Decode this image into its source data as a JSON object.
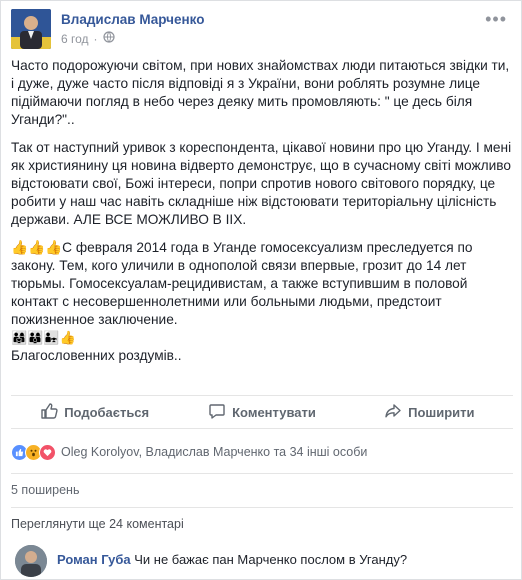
{
  "post": {
    "author": "Владислав Марченко",
    "time": "6 год",
    "paragraphs": [
      "Часто подорожуючи світом, при нових знайомствах люди питаються звідки ти, і дуже, дуже часто після відповіді я з України, вони роблять розумне лице підіймаючи погляд в небо через деяку мить промовляють: \" це десь біля Уганди?\"..",
      "Так от наступний уривок з кореспондента, цікавої новини про цю Уганду. І мені як християнину ця новина відверто демонструє, що в сучасному світі можливо відстоювати свої, Божі інтереси, попри спротив нового світового порядку, це робити у наш час навіть складніше ніж відстоювати територіальну цілісність держави. АЛЕ ВСЕ МОЖЛИВО В ІІХ.",
      "👍👍👍С февраля 2014 года в Уганде гомосексуализм преследуется по закону. Тем, кого уличили в однополой связи впервые, грозит до 14 лет тюрьмы. Гомосексуалам-рецидивистам, а также вступившим в половой контакт с несовершеннолетними или больными людьми, предстоит пожизненное заключение."
    ],
    "emoji_line": "👨‍👩‍👧👨‍👩‍👦👨‍👧👍",
    "closing": "Благословенних роздумів.."
  },
  "actions": {
    "like": "Подобається",
    "comment": "Коментувати",
    "share": "Поширити"
  },
  "reactions": {
    "text": "Oleg Korolyov, Владислав Марченко та 34 інші особи"
  },
  "shares": "5 поширень",
  "more_comments": "Переглянути ще 24 коментарі",
  "comment": {
    "author": "Роман Губа",
    "text": "Чи не бажає пан Марченко послом в Уганду?"
  },
  "colors": {
    "link": "#365899",
    "like_blue": "#5890ff",
    "love_red": "#f25268",
    "wow_yellow": "#f7b125"
  }
}
